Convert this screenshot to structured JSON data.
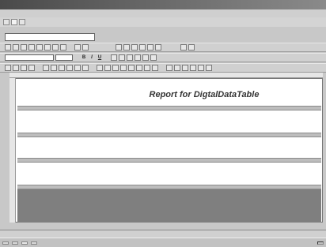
{
  "window": {
    "title": "",
    "menu": [
      "",
      "",
      "",
      "",
      ""
    ]
  },
  "tabs": [
    "",
    "",
    ""
  ],
  "name_box": {
    "value": ""
  },
  "report": {
    "title": "Report for DigtalDataTable",
    "bands": [
      "",
      "",
      "",
      ""
    ]
  },
  "statusbar": {
    "left": "",
    "right": ""
  },
  "taskbar": {
    "items": [
      "",
      "",
      "",
      ""
    ],
    "tray": ""
  }
}
